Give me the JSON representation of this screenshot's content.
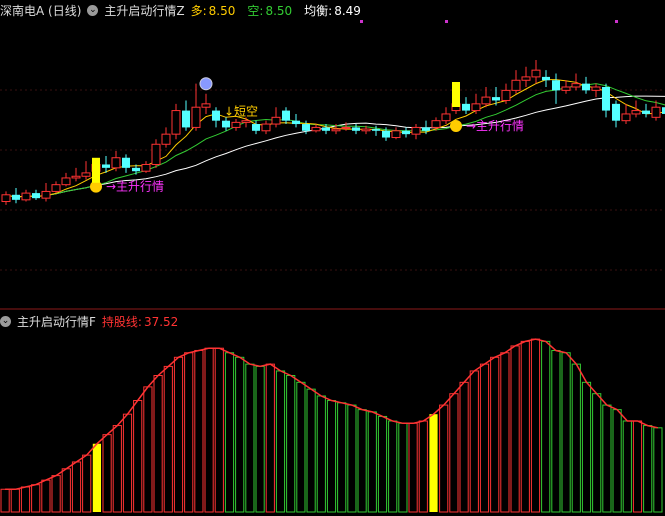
{
  "top_panel": {
    "stock": "深南电A (日线)",
    "indicator": "主升启动行情Z",
    "duo_label": "多:",
    "duo_value": "8.50",
    "kong_label": "空:",
    "kong_value": "8.50",
    "junheng_label": "均衡:",
    "junheng_value": "8.49",
    "annotations": {
      "short_label": "短空",
      "main_rise_label": "主升行情"
    }
  },
  "bottom_panel": {
    "indicator": "主升启动行情F",
    "hold_label": "持股线:",
    "hold_value": "37.52"
  },
  "chart_data": [
    {
      "type": "candlestick",
      "series": [
        {
          "name": "K线",
          "values": [
            [
              8.18,
              8.22,
              8.24,
              8.16
            ],
            [
              8.22,
              8.19,
              8.26,
              8.17
            ],
            [
              8.19,
              8.23,
              8.25,
              8.18
            ],
            [
              8.23,
              8.2,
              8.25,
              8.19
            ],
            [
              8.2,
              8.24,
              8.29,
              8.18
            ],
            [
              8.24,
              8.28,
              8.3,
              8.23
            ],
            [
              8.28,
              8.32,
              8.35,
              8.27
            ],
            [
              8.32,
              8.33,
              8.38,
              8.3
            ],
            [
              8.33,
              8.35,
              8.42,
              8.31
            ],
            [
              8.36,
              8.4,
              8.41,
              8.34
            ],
            [
              8.4,
              8.38,
              8.45,
              8.35
            ],
            [
              8.38,
              8.44,
              8.48,
              8.36
            ],
            [
              8.44,
              8.38,
              8.46,
              8.35
            ],
            [
              8.38,
              8.36,
              8.4,
              8.34
            ],
            [
              8.36,
              8.4,
              8.42,
              8.35
            ],
            [
              8.4,
              8.52,
              8.55,
              8.38
            ],
            [
              8.52,
              8.58,
              8.62,
              8.5
            ],
            [
              8.58,
              8.72,
              8.76,
              8.55
            ],
            [
              8.72,
              8.62,
              8.78,
              8.6
            ],
            [
              8.62,
              8.74,
              8.88,
              8.6
            ],
            [
              8.74,
              8.76,
              8.82,
              8.7
            ],
            [
              8.72,
              8.66,
              8.74,
              8.62
            ],
            [
              8.66,
              8.62,
              8.68,
              8.6
            ],
            [
              8.62,
              8.65,
              8.67,
              8.6
            ],
            [
              8.65,
              8.66,
              8.68,
              8.62
            ],
            [
              8.64,
              8.6,
              8.66,
              8.58
            ],
            [
              8.6,
              8.64,
              8.66,
              8.58
            ],
            [
              8.64,
              8.68,
              8.74,
              8.62
            ],
            [
              8.72,
              8.66,
              8.74,
              8.64
            ],
            [
              8.66,
              8.64,
              8.7,
              8.62
            ],
            [
              8.64,
              8.6,
              8.66,
              8.58
            ],
            [
              8.6,
              8.62,
              8.64,
              8.59
            ],
            [
              8.62,
              8.6,
              8.64,
              8.58
            ],
            [
              8.6,
              8.61,
              8.64,
              8.58
            ],
            [
              8.62,
              8.62,
              8.65,
              8.6
            ],
            [
              8.62,
              8.6,
              8.64,
              8.58
            ],
            [
              8.6,
              8.61,
              8.63,
              8.58
            ],
            [
              8.61,
              8.6,
              8.63,
              8.57
            ],
            [
              8.6,
              8.56,
              8.62,
              8.54
            ],
            [
              8.56,
              8.6,
              8.62,
              8.55
            ],
            [
              8.6,
              8.58,
              8.62,
              8.56
            ],
            [
              8.58,
              8.62,
              8.64,
              8.55
            ],
            [
              8.62,
              8.6,
              8.66,
              8.58
            ],
            [
              8.62,
              8.66,
              8.68,
              8.6
            ],
            [
              8.66,
              8.7,
              8.74,
              8.64
            ],
            [
              8.72,
              8.76,
              8.86,
              8.7
            ],
            [
              8.76,
              8.72,
              8.8,
              8.7
            ],
            [
              8.72,
              8.76,
              8.82,
              8.7
            ],
            [
              8.76,
              8.8,
              8.86,
              8.74
            ],
            [
              8.8,
              8.78,
              8.86,
              8.75
            ],
            [
              8.78,
              8.84,
              8.88,
              8.76
            ],
            [
              8.84,
              8.9,
              8.96,
              8.82
            ],
            [
              8.9,
              8.92,
              8.98,
              8.86
            ],
            [
              8.92,
              8.96,
              9.02,
              8.88
            ],
            [
              8.92,
              8.9,
              8.96,
              8.86
            ],
            [
              8.9,
              8.84,
              8.94,
              8.76
            ],
            [
              8.84,
              8.86,
              8.9,
              8.82
            ],
            [
              8.86,
              8.88,
              8.94,
              8.84
            ],
            [
              8.88,
              8.84,
              8.92,
              8.82
            ],
            [
              8.84,
              8.86,
              8.88,
              8.8
            ],
            [
              8.86,
              8.72,
              8.88,
              8.68
            ],
            [
              8.76,
              8.66,
              8.78,
              8.62
            ],
            [
              8.66,
              8.7,
              8.76,
              8.64
            ],
            [
              8.7,
              8.72,
              8.78,
              8.68
            ],
            [
              8.72,
              8.7,
              8.76,
              8.68
            ],
            [
              8.68,
              8.74,
              8.78,
              8.66
            ],
            [
              8.74,
              8.7,
              8.8,
              8.68
            ]
          ]
        }
      ],
      "signals": [
        {
          "label": "主升行情",
          "index": 9
        },
        {
          "label": "短空",
          "index": 20
        },
        {
          "label": "主升行情",
          "index": 45
        }
      ]
    },
    {
      "type": "bar",
      "series": [
        {
          "name": "持股线",
          "values": [
            10,
            10,
            11,
            12,
            14,
            16,
            19,
            22,
            25,
            30,
            34,
            38,
            43,
            49,
            55,
            60,
            64,
            68,
            70,
            71,
            72,
            72,
            70,
            68,
            65,
            64,
            65,
            62,
            60,
            57,
            54,
            51,
            49,
            48,
            47,
            45,
            44,
            42,
            40,
            39,
            39,
            40,
            43,
            47,
            52,
            57,
            62,
            65,
            68,
            70,
            73,
            75,
            76,
            75,
            71,
            70,
            65,
            57,
            52,
            47,
            45,
            40,
            40,
            38,
            37
          ]
        }
      ],
      "highlight_indices": [
        9,
        42
      ],
      "ylim": [
        0,
        80
      ]
    }
  ]
}
